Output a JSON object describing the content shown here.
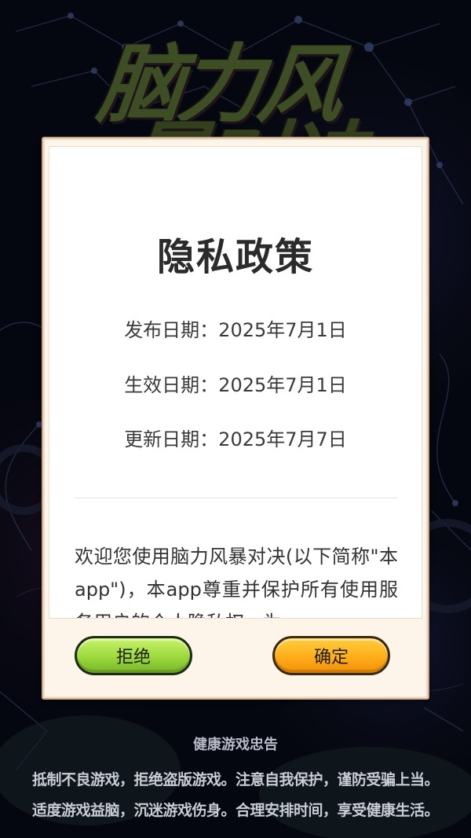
{
  "background": {
    "game_title_line1": "脑力风",
    "game_title_line2": "暴对决"
  },
  "dialog": {
    "title": "隐私政策",
    "published": "发布日期：2025年7月1日",
    "effective": "生效日期：2025年7月1日",
    "updated": "更新日期：2025年7月7日",
    "intro": "欢迎您使用脑力风暴对决(以下简称\"本app\")，本app尊重并保护所有使用服务用户的个人隐私权。为",
    "reject_label": "拒绝",
    "confirm_label": "确定"
  },
  "footer": {
    "notice_title": "健康游戏忠告",
    "line1": "抵制不良游戏，拒绝盗版游戏。注意自我保护，谨防受骗上当。",
    "line2": "适度游戏益脑，沉迷游戏伤身。合理安排时间，享受健康生活。"
  },
  "colors": {
    "reject_button": "#9bd93c",
    "confirm_button": "#ffad1a",
    "dialog_frame": "#fdf4ea"
  }
}
